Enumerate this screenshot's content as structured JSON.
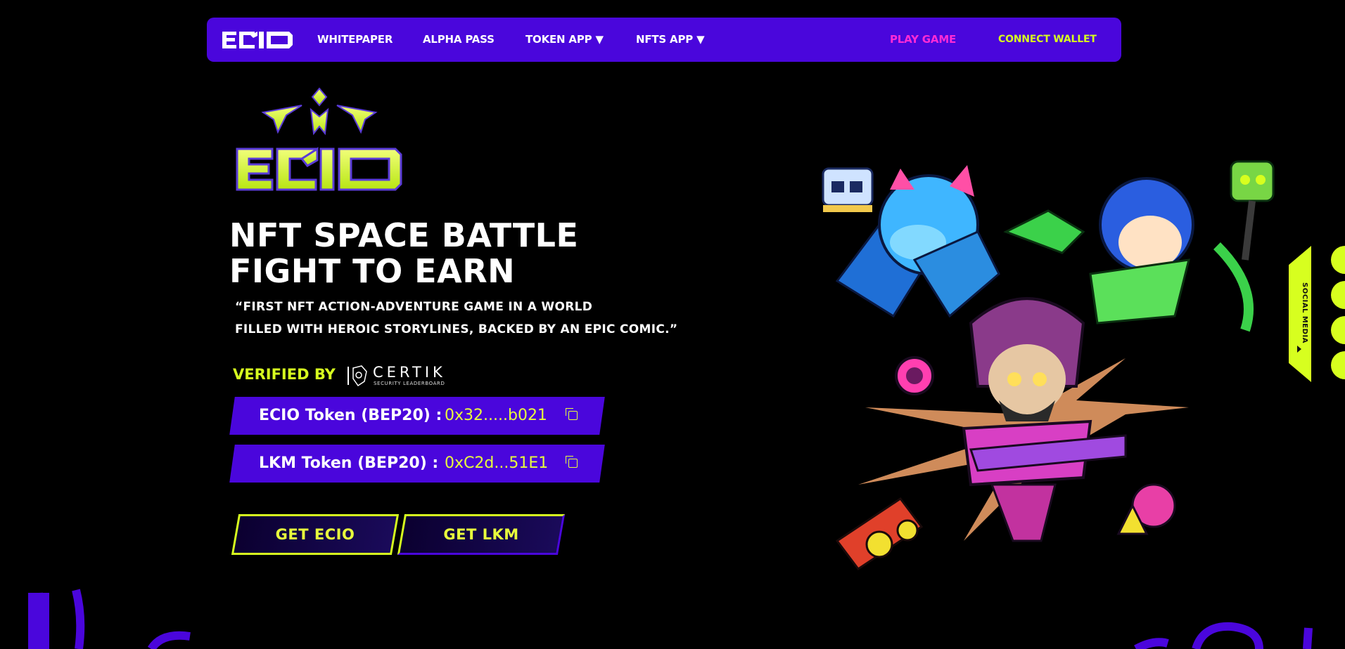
{
  "nav": {
    "logo": "ECIO",
    "items": [
      {
        "label": "WHITEPAPER"
      },
      {
        "label": "ALPHA PASS"
      },
      {
        "label": "TOKEN APP ▼"
      },
      {
        "label": "NFTS APP ▼"
      }
    ],
    "play_game": "PLAY GAME",
    "connect_wallet": "CONNECT WALLET"
  },
  "hero": {
    "logo": "ECIO",
    "headline_line1": "NFT SPACE BATTLE",
    "headline_line2": "FIGHT TO EARN",
    "quote_line1": "“FIRST NFT ACTION-ADVENTURE GAME IN A WORLD",
    "quote_line2": "FILLED WITH HEROIC STORYLINES, BACKED BY AN EPIC COMIC.”",
    "verified_by": "VERIFIED BY",
    "certik_name": "CERTIK",
    "certik_sub": "SECURITY LEADERBOARD",
    "tokens": [
      {
        "label": "ECIO Token (BEP20) :",
        "address": "0x32.....b021"
      },
      {
        "label": "LKM Token (BEP20)  :",
        "address": "0xC2d...51E1"
      }
    ],
    "buttons": {
      "get_ecio": "GET ECIO",
      "get_lkm": "GET LKM"
    }
  },
  "social": {
    "label": "SOCIAL MEDIA"
  },
  "colors": {
    "brand_purple": "#4a06dc",
    "accent_lime": "#d7ff1f",
    "accent_pink": "#ff2bd6",
    "background": "#000000"
  },
  "icons": [
    "copy-icon",
    "certik-logo-icon",
    "chevron-right-icon"
  ]
}
